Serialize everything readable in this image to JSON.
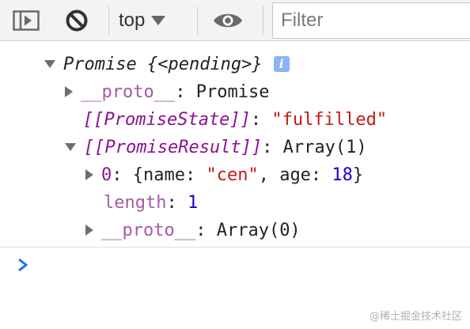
{
  "toolbar": {
    "context": "top",
    "filter_placeholder": "Filter"
  },
  "console": {
    "lines": [
      {
        "label": "Promise",
        "detail": "{<pending>}"
      },
      {
        "key": "__proto__",
        "colon": ":",
        "value": "Promise"
      },
      {
        "key": "[[PromiseState]]",
        "colon": ":",
        "value": "\"fulfilled\""
      },
      {
        "key": "[[PromiseResult]]",
        "colon": ":",
        "value": "Array(1)"
      },
      {
        "key": "0",
        "colon": ":",
        "value_parts": [
          "{name: ",
          "\"cen\"",
          ", age: ",
          "18",
          "}"
        ]
      },
      {
        "key": "length",
        "colon": ":",
        "value": "1"
      },
      {
        "key": "__proto__",
        "colon": ":",
        "value": "Array(0)"
      }
    ],
    "info_icon_text": "i"
  },
  "watermark": "@稀土掘金技术社区",
  "colors": {
    "key": "#881391",
    "string": "#c41a16",
    "number": "#1c00cf",
    "prompt": "#1a73e8",
    "info_badge": "#8ab4f8"
  }
}
